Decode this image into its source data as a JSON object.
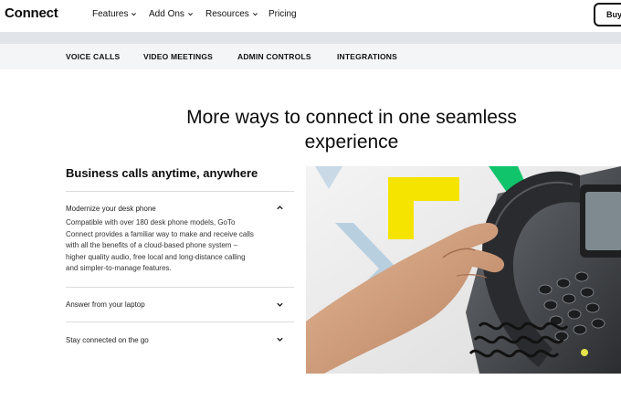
{
  "header": {
    "logo": "Connect",
    "nav": [
      {
        "label": "Features",
        "has_dropdown": true
      },
      {
        "label": "Add Ons",
        "has_dropdown": true
      },
      {
        "label": "Resources",
        "has_dropdown": true
      },
      {
        "label": "Pricing",
        "has_dropdown": false
      }
    ],
    "buy_label": "Buy"
  },
  "subnav": {
    "items": [
      "VOICE CALLS",
      "VIDEO MEETINGS",
      "ADMIN CONTROLS",
      "INTEGRATIONS"
    ]
  },
  "main": {
    "headline_line1": "More ways to connect in one seamless",
    "headline_line2": "experience",
    "section_title": "Business calls anytime, anywhere",
    "accordion": [
      {
        "title": "Modernize your desk phone",
        "expanded": true,
        "body_lines": [
          "Compatible with over 180 desk phone models, GoTo",
          "Connect provides a familiar way to make and receive calls",
          "with all the benefits of a cloud-based phone system –",
          "higher quality audio, free local and long-distance calling",
          "and simpler-to-manage features."
        ]
      },
      {
        "title": "Answer from your laptop",
        "expanded": false
      },
      {
        "title": "Stay connected on the go",
        "expanded": false
      }
    ]
  },
  "colors": {
    "accent_yellow": "#f5e400",
    "accent_green": "#10c46c",
    "accent_blue": "#b8cfe0",
    "subnav_bg": "#f4f5f7",
    "strip_bg": "#e1e4e8"
  },
  "icons": {
    "nav_dropdown": "chevron-down-icon",
    "accordion_open": "chevron-up-icon",
    "accordion_closed": "chevron-down-icon"
  }
}
